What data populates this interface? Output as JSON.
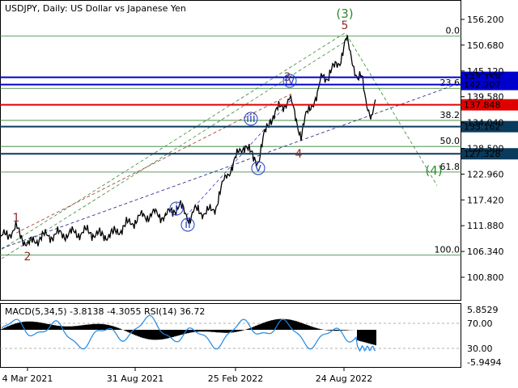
{
  "header": {
    "title": "USDJPY, Daily:  US Dollar vs Japanese Yen"
  },
  "chart_data": [
    {
      "type": "line",
      "symbol": "USDJPY",
      "timeframe": "Daily",
      "ylim": [
        96.7,
        158.7
      ],
      "y_ticks": [
        "156.200",
        "150.680",
        "145.120",
        "139.580",
        "134.040",
        "128.500",
        "122.960",
        "117.420",
        "111.880",
        "106.340",
        "100.800"
      ],
      "x_ticks": [
        "4 Mar 2021",
        "31 Aug 2021",
        "25 Feb 2022",
        "24 Aug 2022"
      ],
      "price_series": [
        [
          0,
          109.0
        ],
        [
          10,
          110.2
        ],
        [
          20,
          111.3
        ],
        [
          24,
          110.0
        ],
        [
          35,
          107.8
        ],
        [
          50,
          109.4
        ],
        [
          70,
          110.0
        ],
        [
          90,
          110.2
        ],
        [
          110,
          110.6
        ],
        [
          125,
          109.7
        ],
        [
          140,
          110.1
        ],
        [
          155,
          111.9
        ],
        [
          175,
          113.8
        ],
        [
          190,
          114.4
        ],
        [
          205,
          113.9
        ],
        [
          215,
          115.4
        ],
        [
          222,
          116.2
        ],
        [
          228,
          114.6
        ],
        [
          234,
          113.6
        ],
        [
          240,
          115.0
        ],
        [
          250,
          114.9
        ],
        [
          262,
          114.9
        ],
        [
          266,
          115.8
        ],
        [
          272,
          119.3
        ],
        [
          280,
          122.5
        ],
        [
          288,
          125.3
        ],
        [
          295,
          127.4
        ],
        [
          303,
          129.6
        ],
        [
          312,
          126.4
        ],
        [
          319,
          125.8
        ],
        [
          326,
          130.8
        ],
        [
          334,
          134.8
        ],
        [
          342,
          136.5
        ],
        [
          350,
          137.8
        ],
        [
          358,
          139.2
        ],
        [
          366,
          134.8
        ],
        [
          372,
          131.2
        ],
        [
          378,
          135.2
        ],
        [
          385,
          138.2
        ],
        [
          392,
          139.6
        ],
        [
          398,
          144.2
        ],
        [
          405,
          143.9
        ],
        [
          413,
          145.9
        ],
        [
          420,
          147.4
        ],
        [
          428,
          151.9
        ],
        [
          436,
          147.1
        ],
        [
          442,
          143.2
        ],
        [
          447,
          143.6
        ],
        [
          452,
          139.3
        ],
        [
          459,
          134.8
        ],
        [
          464,
          137.9
        ]
      ],
      "macd_rsi": {
        "label": "MACD(5,34,5) -3.8138 -4.3055 RSI(14) 36.72",
        "y_ticks": [
          "5.8529",
          "70.00",
          "30.00",
          "-5.9494"
        ]
      },
      "levels": [
        {
          "label": "143.759",
          "color": "#0000cc",
          "value": 143.759
        },
        {
          "label": "142.207",
          "color": "#0000cc",
          "value": 142.207
        },
        {
          "label": "137.848",
          "color": "#e00000",
          "value": 137.848
        },
        {
          "label": "133.162",
          "color": "#0a3a5c",
          "value": 133.162
        },
        {
          "label": "127.328",
          "color": "#0a3a5c",
          "value": 127.328
        }
      ],
      "fibonacci": [
        {
          "label": "0.0",
          "value": 152.6
        },
        {
          "label": "23.6",
          "value": 141.4
        },
        {
          "label": "38.2",
          "value": 134.5
        },
        {
          "label": "50.0",
          "value": 128.9
        },
        {
          "label": "61.8",
          "value": 123.4
        },
        {
          "label": "100.0",
          "value": 105.6
        }
      ],
      "wave_labels": [
        {
          "text": "1",
          "color": "#8b2b2b"
        },
        {
          "text": "2",
          "color": "#8b2b2b"
        },
        {
          "text": "3",
          "color": "#8b2b2b"
        },
        {
          "text": "4",
          "color": "#8b2b2b"
        },
        {
          "text": "5",
          "color": "#8b2b2b"
        },
        {
          "text": "(3)",
          "color": "#2e8b2e"
        },
        {
          "text": "(4)",
          "color": "#2e8b2e"
        },
        {
          "text": "i",
          "color": "#1f3fbf",
          "circled": true
        },
        {
          "text": "ii",
          "color": "#1f3fbf",
          "circled": true
        },
        {
          "text": "iii",
          "color": "#1f3fbf",
          "circled": true
        },
        {
          "text": "iv",
          "color": "#1f3fbf",
          "circled": true
        },
        {
          "text": "v",
          "color": "#1f3fbf",
          "circled": true
        }
      ],
      "colors": {
        "price": "#000000",
        "macd_hist": "#000000",
        "rsi": "#1e88e5",
        "fib": "#2e7d32",
        "grid": "#c8c8c8"
      }
    }
  ]
}
